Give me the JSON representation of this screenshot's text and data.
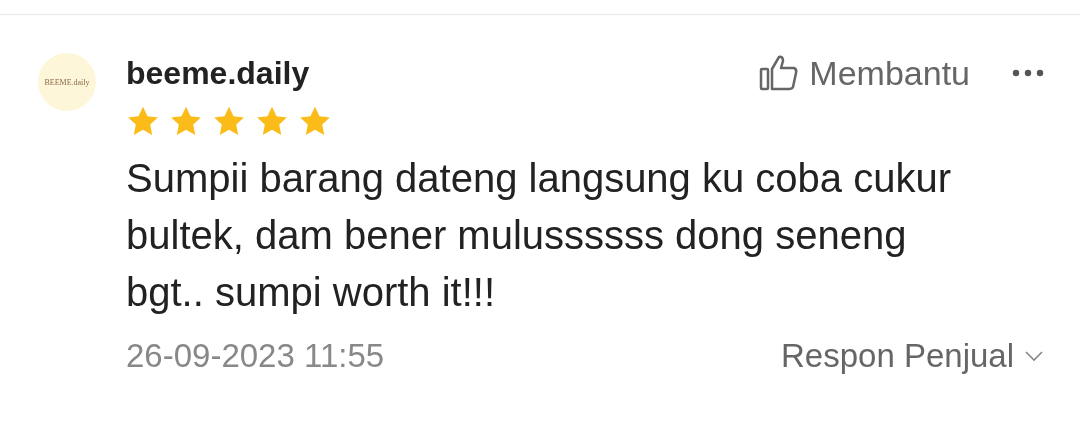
{
  "review": {
    "avatar_logo": "BEEME.daily",
    "username": "beeme.daily",
    "stars": 5,
    "helpful_label": "Membantu",
    "comment": "Sumpii barang dateng langsung ku coba cukur bultek, dam bener mulussssss dong seneng bgt.. sumpi worth it!!!",
    "date": "26-09-2023 11:55",
    "seller_response_label": "Respon Penjual"
  }
}
